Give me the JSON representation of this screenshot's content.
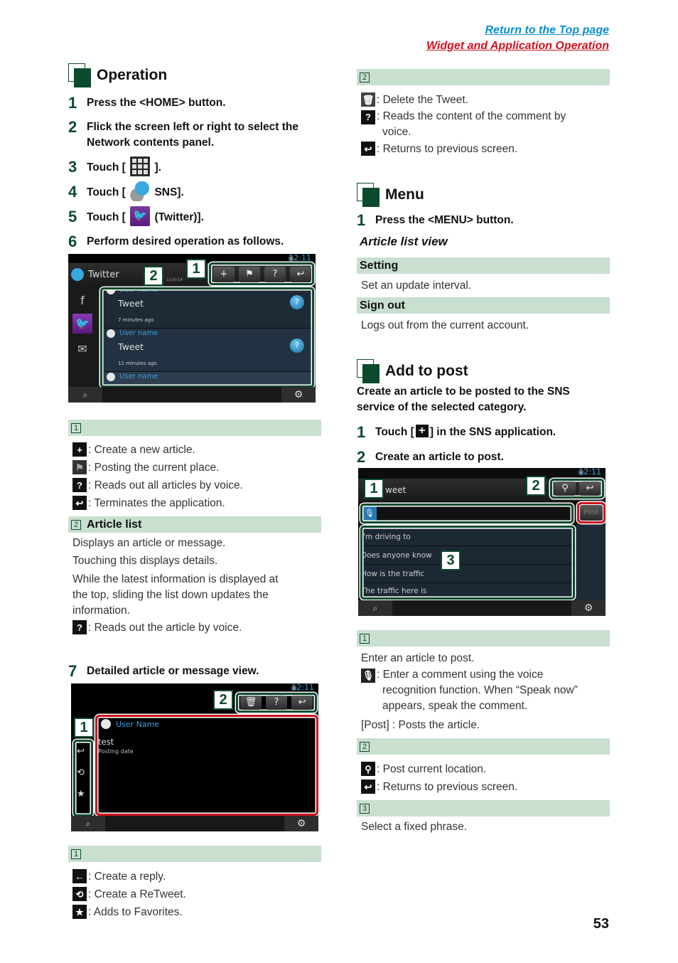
{
  "header": {
    "link_top": "Return to the Top page",
    "link_section": "Widget and Application Operation"
  },
  "colors": {
    "accent_green": "#0c4a2e",
    "band": "#c9dfd0",
    "link_blue": "#0a8fd0",
    "link_red": "#d0101e",
    "frame_red": "#d0101e"
  },
  "operation": {
    "title": "Operation",
    "steps": [
      {
        "num": "1",
        "text": "Press the <HOME> button."
      },
      {
        "num": "2",
        "text": "Flick the screen left or right to select the Network contents panel."
      },
      {
        "num": "3",
        "pre": "Touch [",
        "post": "].",
        "icon": "apps-grid-icon"
      },
      {
        "num": "4",
        "pre": "Touch [",
        "post": "SNS].",
        "icon": "sns-icon"
      },
      {
        "num": "5",
        "pre": "Touch [",
        "post": "(Twitter)].",
        "icon": "twitter-icon"
      },
      {
        "num": "6",
        "text": "Perform desired operation as follows."
      },
      {
        "num": "7",
        "text": "Detailed article or message view."
      }
    ],
    "screen1": {
      "title": "Twitter",
      "time": "12:11",
      "date": "1/16/14",
      "callouts": [
        "1",
        "2"
      ],
      "rows": [
        {
          "user": "User name",
          "tweet": "Tweet",
          "ago": "7 minutes ago"
        },
        {
          "user": "User name",
          "tweet": "Tweet",
          "ago": "11 minutes ago"
        },
        {
          "user": "User name"
        }
      ],
      "toolbar": [
        "+",
        "⚑",
        "?",
        "↩"
      ],
      "sidebar": [
        "f",
        "🐦",
        "✉"
      ]
    },
    "legend1": {
      "num": "1",
      "items": [
        {
          "icon": "plus-icon",
          "glyph": "+",
          "text": ": Create a new article."
        },
        {
          "icon": "flag-icon",
          "glyph": "⚑",
          "text": ": Posting the current place."
        },
        {
          "icon": "read-all-icon",
          "glyph": "?",
          "text": ": Reads out all articles by voice."
        },
        {
          "icon": "back-icon",
          "glyph": "↩",
          "text": ": Terminates the application."
        }
      ]
    },
    "legend2": {
      "num": "2",
      "title": "Article list",
      "lines": [
        "Displays an article or message.",
        "Touching this displays details.",
        "While the latest information is displayed at the top, sliding the list down updates the information."
      ],
      "voice_item": {
        "icon": "voice-read-icon",
        "glyph": "?",
        "text": ": Reads out the article by voice."
      }
    },
    "screen2": {
      "time": "12:11",
      "user": "User Name",
      "text": "test",
      "date_label": "Posting date",
      "callouts": [
        "1",
        "2"
      ],
      "toolbar": [
        "🗑",
        "?",
        "↩"
      ],
      "side": [
        "↩",
        "⟲",
        "★"
      ]
    },
    "legend3": {
      "num": "1",
      "items": [
        {
          "icon": "reply-icon",
          "glyph": "←",
          "text": ": Create a reply."
        },
        {
          "icon": "retweet-icon",
          "glyph": "⟲",
          "text": ": Create a ReTweet."
        },
        {
          "icon": "star-icon",
          "glyph": "★",
          "text": ": Adds to Favorites."
        }
      ]
    }
  },
  "right": {
    "legend2": {
      "num": "2",
      "items": [
        {
          "icon": "trash-icon",
          "glyph": "🗑",
          "text": ": Delete the Tweet."
        },
        {
          "icon": "voice-read-icon",
          "glyph": "?",
          "text": ": Reads the content of the comment by voice."
        },
        {
          "icon": "back-icon",
          "glyph": "↩",
          "text": ": Returns to previous screen."
        }
      ]
    },
    "menu": {
      "title": "Menu",
      "step1": {
        "num": "1",
        "text": "Press the <MENU> button."
      },
      "subhead": "Article list view",
      "rows": [
        {
          "label": "Setting",
          "desc": "Set an update interval."
        },
        {
          "label": "Sign out",
          "desc": "Logs out from the current account."
        }
      ]
    },
    "add": {
      "title": "Add to post",
      "intro": "Create an article to be posted to the SNS service of the selected category.",
      "step1": {
        "num": "1",
        "pre": "Touch [",
        "post": "] in the SNS application."
      },
      "step2": {
        "num": "2",
        "text": "Create an article to post."
      },
      "screen": {
        "time": "12:11",
        "title": "weet",
        "post_button": "Post",
        "callouts": [
          "1",
          "2",
          "3"
        ],
        "phrases": [
          "I'm driving to",
          "Does anyone know",
          "How is the traffic",
          "The traffic here is"
        ]
      },
      "legend1": {
        "num": "1",
        "intro": "Enter an article to post.",
        "mic": {
          "icon": "mic-icon",
          "glyph": "🎙",
          "text": ": Enter a comment using the voice recognition function. When “Speak now” appears, speak the comment."
        },
        "post": "[Post] : Posts the article."
      },
      "legend2": {
        "num": "2",
        "items": [
          {
            "icon": "location-pin-icon",
            "glyph": "⚲",
            "text": ": Post current location."
          },
          {
            "icon": "back-icon",
            "glyph": "↩",
            "text": ": Returns to previous screen."
          }
        ]
      },
      "legend3": {
        "num": "3",
        "text": "Select a fixed phrase."
      }
    }
  },
  "page_number": "53"
}
